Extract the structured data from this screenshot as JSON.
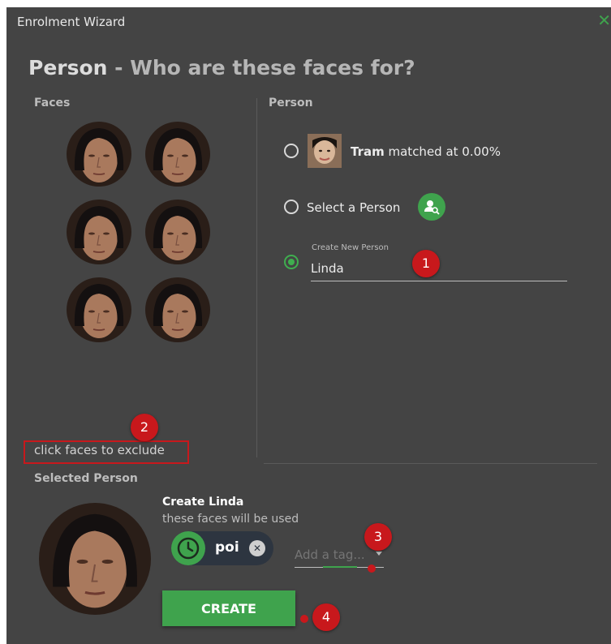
{
  "window": {
    "title": "Enrolment Wizard",
    "close_icon": "close-icon"
  },
  "heading": {
    "main": "Person",
    "sep": " - ",
    "sub": "Who are these faces for?"
  },
  "faces": {
    "label": "Faces",
    "count": 6,
    "hint": "click faces to exclude"
  },
  "person": {
    "label": "Person",
    "options": {
      "matched": {
        "name": "Tram",
        "text": " matched at 0.00%"
      },
      "select": {
        "label": "Select a Person",
        "icon": "person-search-icon"
      },
      "create": {
        "label": "Create New Person",
        "value": "Linda",
        "selected": true
      }
    }
  },
  "selected_person": {
    "label": "Selected Person",
    "title": "Create Linda",
    "subtitle": "these faces will be used",
    "tag_chip": {
      "label": "poi",
      "icon": "clock-icon",
      "remove_icon": "close-circle-icon"
    },
    "tag_input": {
      "placeholder": "Add a tag..."
    },
    "create_label": "CREATE"
  },
  "callouts": [
    "1",
    "2",
    "3",
    "4"
  ],
  "colors": {
    "accent": "#3fa34d",
    "background": "#444444",
    "callout": "#c8181c"
  }
}
